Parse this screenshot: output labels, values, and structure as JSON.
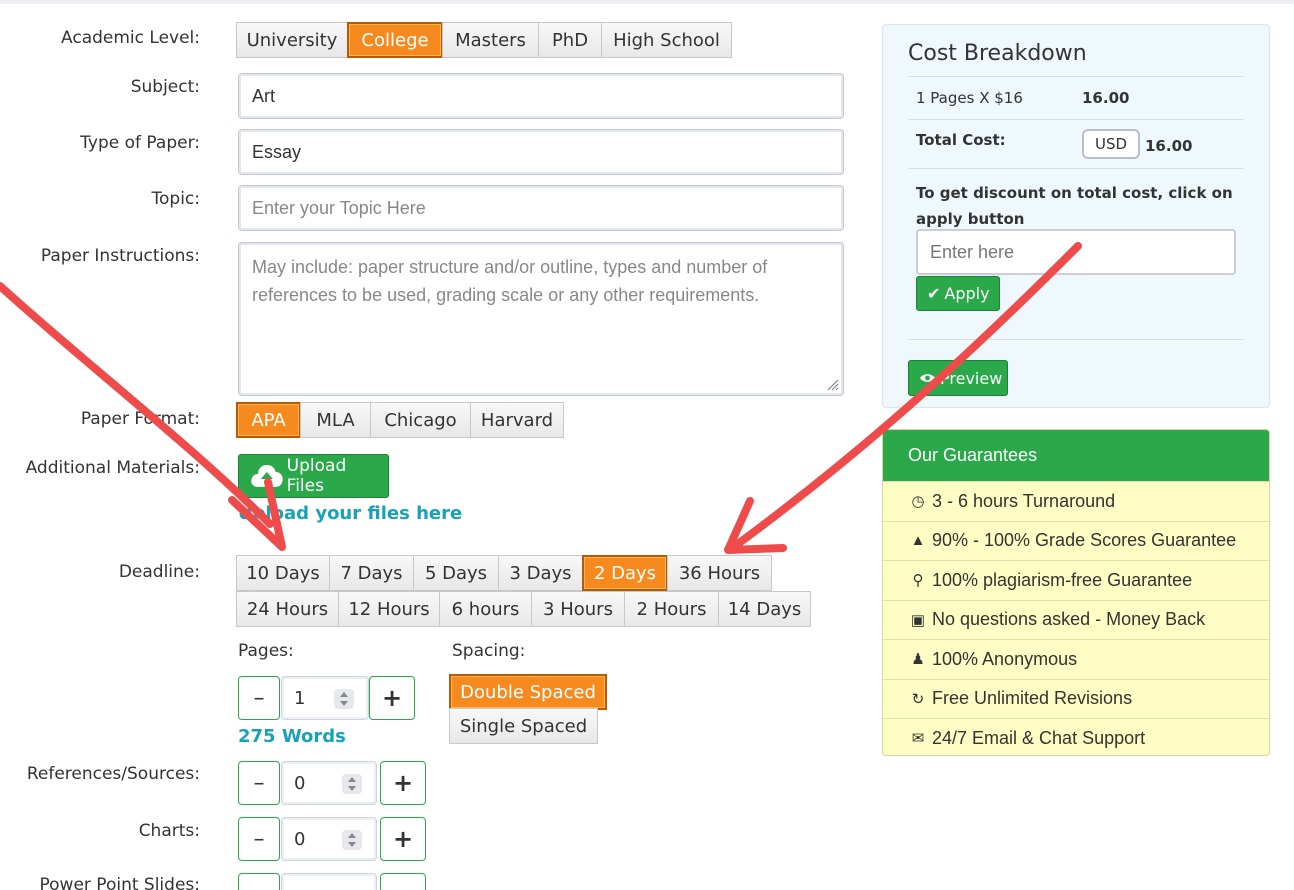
{
  "form": {
    "academic_level": {
      "label": "Academic Level:",
      "options": [
        "University",
        "College",
        "Masters",
        "PhD",
        "High School"
      ],
      "selected": "College"
    },
    "subject": {
      "label": "Subject:",
      "value": "Art"
    },
    "paper_type": {
      "label": "Type of Paper:",
      "value": "Essay"
    },
    "topic": {
      "label": "Topic:",
      "placeholder": "Enter your Topic Here"
    },
    "instructions": {
      "label": "Paper Instructions:",
      "placeholder": "May include: paper structure and/or outline, types and number of references to be used, grading scale or any other requirements."
    },
    "paper_format": {
      "label": "Paper Format:",
      "options": [
        "APA",
        "MLA",
        "Chicago",
        "Harvard"
      ],
      "selected": "APA"
    },
    "materials": {
      "label": "Additional Materials:",
      "upload_label": "Upload Files",
      "upload_link": "Upload your files here"
    },
    "deadline": {
      "label": "Deadline:",
      "row1": [
        "10 Days",
        "7 Days",
        "5 Days",
        "3 Days",
        "2 Days",
        "36 Hours"
      ],
      "row2": [
        "24 Hours",
        "12 Hours",
        "6 hours",
        "3 Hours",
        "2 Hours",
        "14 Days"
      ],
      "selected": "2 Days"
    },
    "pages": {
      "label": "Pages:",
      "value": "1",
      "words": "275 Words",
      "minus": "–",
      "plus": "+"
    },
    "spacing": {
      "label": "Spacing:",
      "options": [
        "Double Spaced",
        "Single Spaced"
      ],
      "selected": "Double Spaced"
    },
    "references": {
      "label": "References/Sources:",
      "value": "0"
    },
    "charts": {
      "label": "Charts:",
      "value": "0"
    },
    "slides": {
      "label": "Power Point Slides:"
    }
  },
  "cost": {
    "title": "Cost Breakdown",
    "line": "1 Pages X $16",
    "line_value": "16.00",
    "total_label": "Total Cost:",
    "currency": "USD",
    "total_value": "16.00",
    "discount_text": "To get discount on total cost, click on apply button",
    "coupon_placeholder": "Enter here",
    "apply_label": "Apply",
    "preview_label": "Preview"
  },
  "guarantees": {
    "title": "Our Guarantees",
    "items": [
      {
        "icon": "clock-icon",
        "text": "3 - 6 hours Turnaround"
      },
      {
        "icon": "graduation-cap-icon",
        "text": "90% - 100% Grade Scores Guarantee"
      },
      {
        "icon": "search-icon",
        "text": "100% plagiarism-free Guarantee"
      },
      {
        "icon": "money-icon",
        "text": "No questions asked - Money Back"
      },
      {
        "icon": "user-secret-icon",
        "text": "100% Anonymous"
      },
      {
        "icon": "refresh-icon",
        "text": "Free Unlimited Revisions"
      },
      {
        "icon": "comments-icon",
        "text": "24/7 Email & Chat Support"
      }
    ]
  },
  "colors": {
    "accent_orange": "#f68a1e",
    "success_green": "#2aa84a",
    "link_teal": "#17a2b8",
    "annotation_red": "#ef4b4b",
    "guarantee_bg": "#fdfdc4",
    "cost_bg": "#eef8fd"
  }
}
